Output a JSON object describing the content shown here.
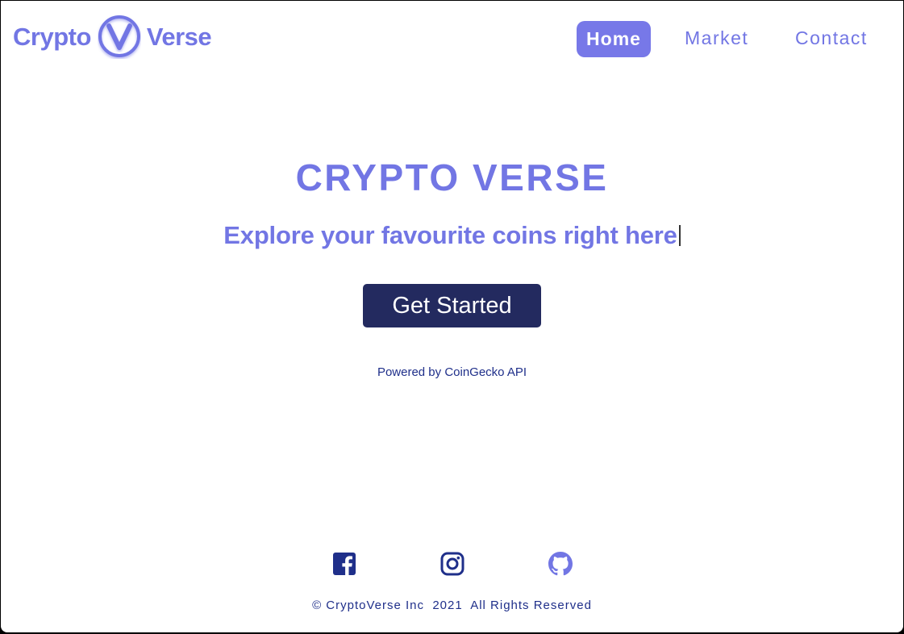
{
  "header": {
    "logo_left": "Crypto",
    "logo_right": "Verse",
    "logo_icon": "v-circle-logo-icon",
    "nav": {
      "home": "Home",
      "market": "Market",
      "contact": "Contact"
    }
  },
  "hero": {
    "title": "CRYPTO VERSE",
    "subtitle": "Explore your favourite coins right here",
    "cta_label": "Get Started",
    "powered_by": "Powered by CoinGecko API"
  },
  "footer": {
    "social_icons": [
      "facebook-icon",
      "instagram-icon",
      "github-icon"
    ],
    "copyright": "© CryptoVerse Inc  2021  All Rights Reserved"
  },
  "colors": {
    "brand": "#7276e4",
    "nav_active_bg": "#7778e8",
    "cta_bg": "#232a5f",
    "footer_text": "#1f2f8a"
  }
}
